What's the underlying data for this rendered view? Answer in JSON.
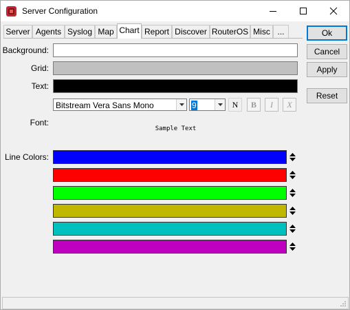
{
  "window": {
    "title": "Server Configuration",
    "app_icon": "app-icon"
  },
  "tabs": [
    {
      "label": "Server"
    },
    {
      "label": "Agents"
    },
    {
      "label": "Syslog"
    },
    {
      "label": "Map"
    },
    {
      "label": "Chart",
      "active": true
    },
    {
      "label": "Report"
    },
    {
      "label": "Discover"
    },
    {
      "label": "RouterOS"
    },
    {
      "label": "Misc"
    },
    {
      "label": "..."
    }
  ],
  "chart": {
    "background_label": "Background:",
    "background_color": "#ffffff",
    "grid_label": "Grid:",
    "grid_color": "#c0c0c0",
    "text_label": "Text:",
    "text_color": "#000000",
    "font_label": "Font:",
    "font_name": "Bitstream Vera Sans Mono",
    "font_size": "9",
    "format_buttons": [
      "N",
      "B",
      "I",
      "X"
    ],
    "sample_text": "Sample Text",
    "line_colors_label": "Line Colors:",
    "line_colors": [
      "#0000ff",
      "#ff0000",
      "#00ff00",
      "#c0b800",
      "#00c0c0",
      "#c000c0"
    ]
  },
  "buttons": {
    "ok": "Ok",
    "cancel": "Cancel",
    "apply": "Apply",
    "reset": "Reset"
  }
}
